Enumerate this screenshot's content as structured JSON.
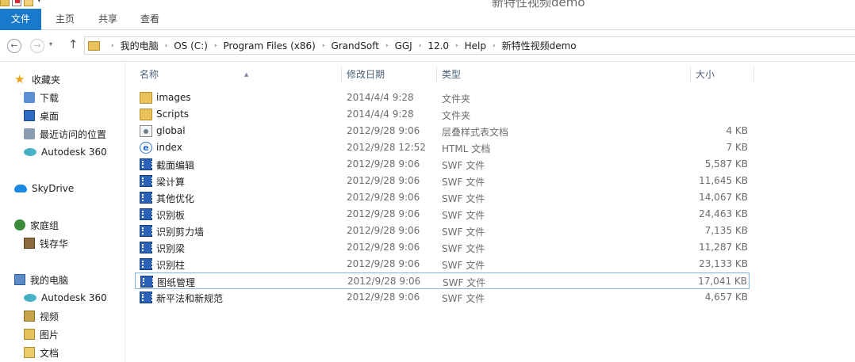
{
  "window": {
    "title": "新特性视频demo"
  },
  "ribbon": {
    "tabs": [
      {
        "label": "文件"
      },
      {
        "label": "主页"
      },
      {
        "label": "共享"
      },
      {
        "label": "查看"
      }
    ]
  },
  "address": {
    "crumbs": [
      "我的电脑",
      "OS (C:)",
      "Program Files (x86)",
      "GrandSoft",
      "GGJ",
      "12.0",
      "Help",
      "新特性视频demo"
    ]
  },
  "sidebar": {
    "favorites": {
      "label": "收藏夹",
      "icon": "star-icon"
    },
    "favorite_items": [
      {
        "label": "下载",
        "icon": "downloads-icon"
      },
      {
        "label": "桌面",
        "icon": "desktop-icon"
      },
      {
        "label": "最近访问的位置",
        "icon": "recent-places-icon"
      },
      {
        "label": "Autodesk 360",
        "icon": "autodesk-360-icon"
      }
    ],
    "skydrive": {
      "label": "SkyDrive",
      "icon": "skydrive-icon"
    },
    "homegroup": {
      "label": "家庭组",
      "icon": "homegroup-icon"
    },
    "homegroup_items": [
      {
        "label": "钱存华",
        "icon": "user-icon"
      }
    ],
    "computer": {
      "label": "我的电脑",
      "icon": "computer-icon"
    },
    "computer_items": [
      {
        "label": "Autodesk 360",
        "icon": "autodesk-360-icon"
      },
      {
        "label": "视频",
        "icon": "videos-icon"
      },
      {
        "label": "图片",
        "icon": "pictures-icon"
      },
      {
        "label": "文档",
        "icon": "documents-icon"
      }
    ]
  },
  "filelist": {
    "columns": {
      "name": "名称",
      "date": "修改日期",
      "type": "类型",
      "size": "大小"
    },
    "rows": [
      {
        "name": "images",
        "date": "2014/4/4 9:28",
        "type": "文件夹",
        "size": "",
        "icon": "folder"
      },
      {
        "name": "Scripts",
        "date": "2014/4/4 9:28",
        "type": "文件夹",
        "size": "",
        "icon": "folder"
      },
      {
        "name": "global",
        "date": "2012/9/28 9:06",
        "type": "层叠样式表文档",
        "size": "4 KB",
        "icon": "css"
      },
      {
        "name": "index",
        "date": "2012/9/28 12:52",
        "type": "HTML 文档",
        "size": "7 KB",
        "icon": "html"
      },
      {
        "name": "截面编辑",
        "date": "2012/9/28 9:06",
        "type": "SWF 文件",
        "size": "5,587 KB",
        "icon": "swf"
      },
      {
        "name": "梁计算",
        "date": "2012/9/28 9:06",
        "type": "SWF 文件",
        "size": "11,645 KB",
        "icon": "swf"
      },
      {
        "name": "其他优化",
        "date": "2012/9/28 9:06",
        "type": "SWF 文件",
        "size": "14,067 KB",
        "icon": "swf"
      },
      {
        "name": "识别板",
        "date": "2012/9/28 9:06",
        "type": "SWF 文件",
        "size": "24,463 KB",
        "icon": "swf"
      },
      {
        "name": "识别剪力墙",
        "date": "2012/9/28 9:06",
        "type": "SWF 文件",
        "size": "7,135 KB",
        "icon": "swf"
      },
      {
        "name": "识别梁",
        "date": "2012/9/28 9:06",
        "type": "SWF 文件",
        "size": "11,287 KB",
        "icon": "swf"
      },
      {
        "name": "识别柱",
        "date": "2012/9/28 9:06",
        "type": "SWF 文件",
        "size": "23,133 KB",
        "icon": "swf"
      },
      {
        "name": "图纸管理",
        "date": "2012/9/28 9:06",
        "type": "SWF 文件",
        "size": "17,041 KB",
        "icon": "swf",
        "selected": true
      },
      {
        "name": "新平法和新规范",
        "date": "2012/9/28 9:06",
        "type": "SWF 文件",
        "size": "4,657 KB",
        "icon": "swf"
      }
    ]
  },
  "colors": {
    "file_tab": "#1979ca",
    "selection_border": "#7eb4ea",
    "header_text": "#4c607a",
    "folder": "#e9c15a",
    "swf": "#2b62b8"
  }
}
